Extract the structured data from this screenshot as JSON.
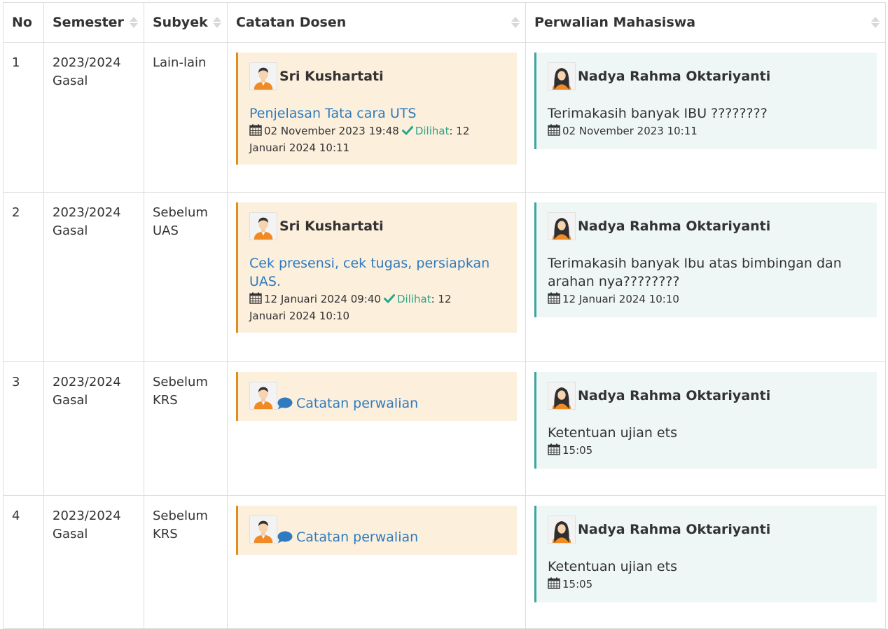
{
  "table": {
    "headers": {
      "no": "No",
      "semester": "Semester",
      "subyek": "Subyek",
      "catatan": "Catatan Dosen",
      "perwalian": "Perwalian Mahasiswa"
    }
  },
  "rows": [
    {
      "no": "1",
      "semester_line1": "2023/2024",
      "semester_line2": "Gasal",
      "subyek_line1": "Lain-lain",
      "subyek_line2": "",
      "note": {
        "author": "Sri Kushartati",
        "title": "Penjelasan Tata cara UTS",
        "date": "02 November 2023 19:48",
        "seen_label": "Dilihat",
        "seen_sep": ": 12",
        "seen_date_rest": "Januari 2024 10:11"
      },
      "reply": {
        "author": "Nadya Rahma Oktariyanti",
        "text": "Terimakasih banyak IBU ????????",
        "date": "02 November 2023 10:11"
      }
    },
    {
      "no": "2",
      "semester_line1": "2023/2024",
      "semester_line2": "Gasal",
      "subyek_line1": "Sebelum",
      "subyek_line2": "UAS",
      "note": {
        "author": "Sri Kushartati",
        "title": "Cek presensi, cek tugas, persiapkan UAS.",
        "date": "12 Januari 2024 09:40",
        "seen_label": "Dilihat",
        "seen_sep": ": 12",
        "seen_date_rest": "Januari 2024 10:10"
      },
      "reply": {
        "author": "Nadya Rahma Oktariyanti",
        "text": "Terimakasih banyak Ibu atas bimbingan dan arahan nya????????",
        "date": "12 Januari 2024 10:10"
      }
    },
    {
      "no": "3",
      "semester_line1": "2023/2024",
      "semester_line2": "Gasal",
      "subyek_line1": "Sebelum",
      "subyek_line2": "KRS",
      "note": {
        "link": "Catatan perwalian"
      },
      "reply": {
        "author": "Nadya Rahma Oktariyanti",
        "text": "Ketentuan ujian ets",
        "date": "15:05"
      }
    },
    {
      "no": "4",
      "semester_line1": "2023/2024",
      "semester_line2": "Gasal",
      "subyek_line1": "Sebelum",
      "subyek_line2": "KRS",
      "note": {
        "link": "Catatan perwalian"
      },
      "reply": {
        "author": "Nadya Rahma Oktariyanti",
        "text": "Ketentuan ujian ets",
        "date": "15:05"
      }
    }
  ],
  "icons": {
    "calendar": "calendar-icon",
    "check": "check-icon",
    "comment": "comment-bubble-icon",
    "lecturer_avatar": "male-avatar-icon",
    "student_avatar": "female-hijab-avatar-icon",
    "sort": "sort-icon"
  },
  "colors": {
    "note_bg": "#fcefdc",
    "note_border": "#e08e1a",
    "reply_bg": "#eff6f6",
    "reply_border": "#3aa6a0",
    "link": "#2e7bbf",
    "seen": "#2aa58a"
  }
}
